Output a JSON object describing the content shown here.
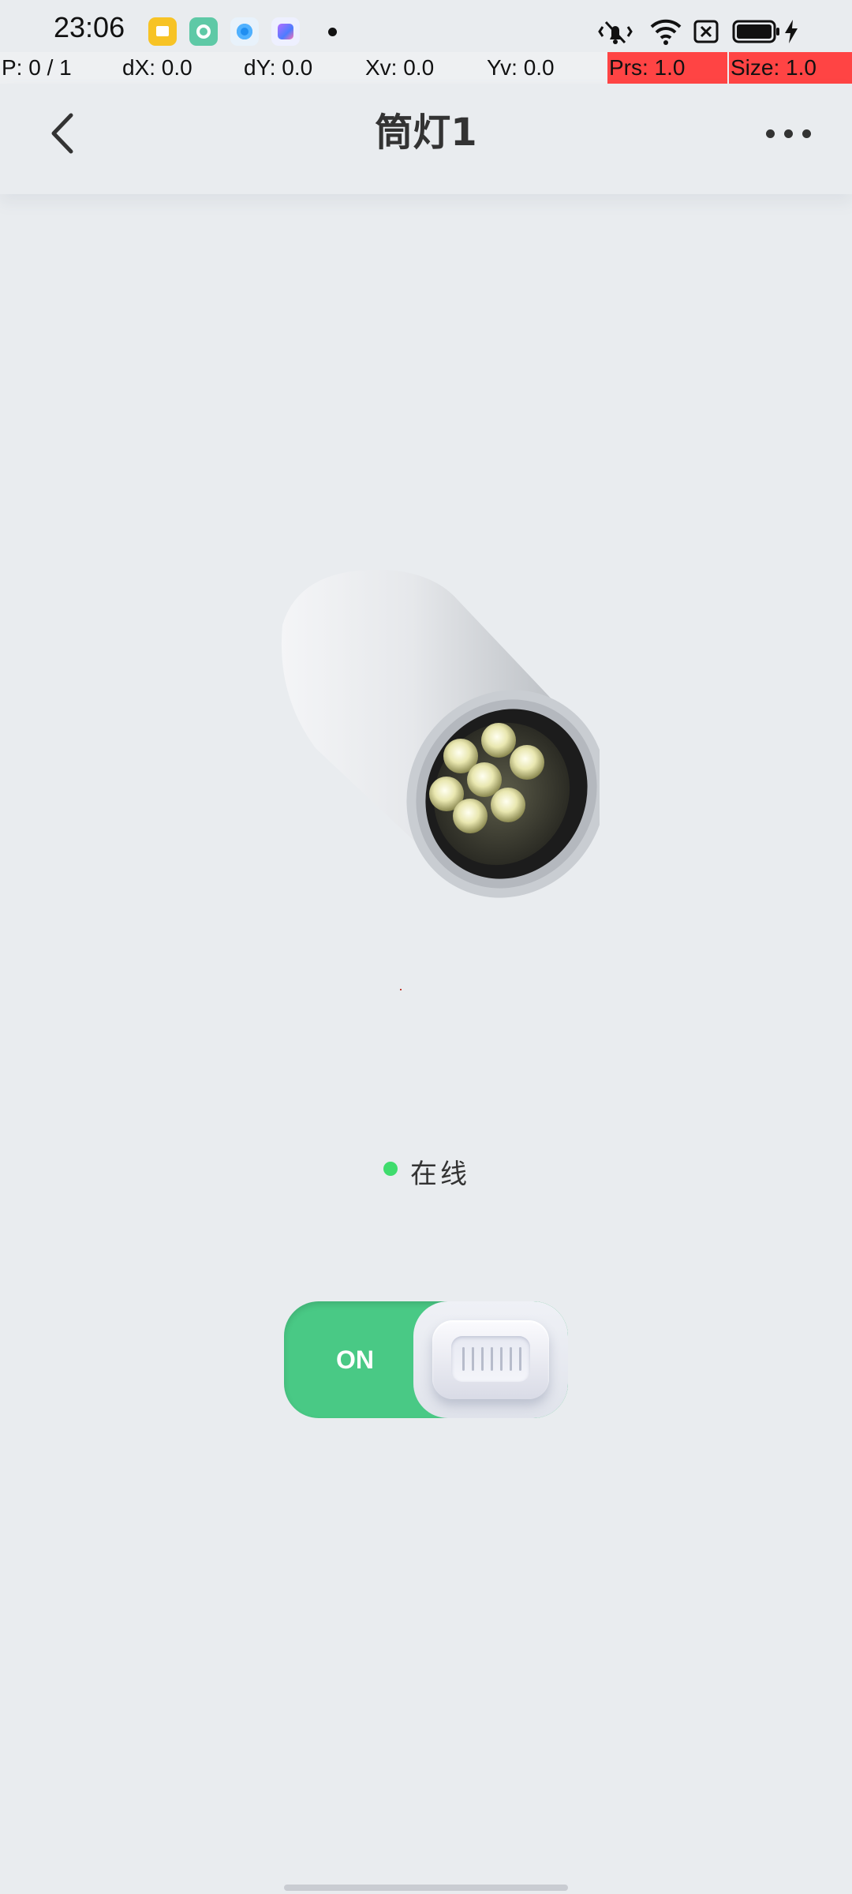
{
  "status_bar": {
    "time": "23:06",
    "app_icons": [
      "files-icon",
      "camera-icon",
      "browser-icon",
      "game-center-icon"
    ],
    "system_icons": [
      "mute-vibrate-icon",
      "wifi-icon",
      "no-sim-icon",
      "battery-icon",
      "charging-icon"
    ]
  },
  "pointer_bar": {
    "p": "P: 0 / 1",
    "dx": "dX: 0.0",
    "dy": "dY: 0.0",
    "xv": "Xv: 0.0",
    "yv": "Yv: 0.0",
    "prs": "Prs: 1.0",
    "size": "Size: 1.0",
    "highlight_color": "#ff4444"
  },
  "header": {
    "title": "筒灯1",
    "back_icon": "chevron-left-icon",
    "more_icon": "more-dots-icon"
  },
  "device": {
    "image": "downlight-illustration"
  },
  "status": {
    "label": "在线",
    "dot_color": "#3fdc6d"
  },
  "power_toggle": {
    "label": "ON",
    "state": "on",
    "color": "#49c985"
  },
  "colors": {
    "background": "#e9ecef",
    "text": "#333333"
  }
}
